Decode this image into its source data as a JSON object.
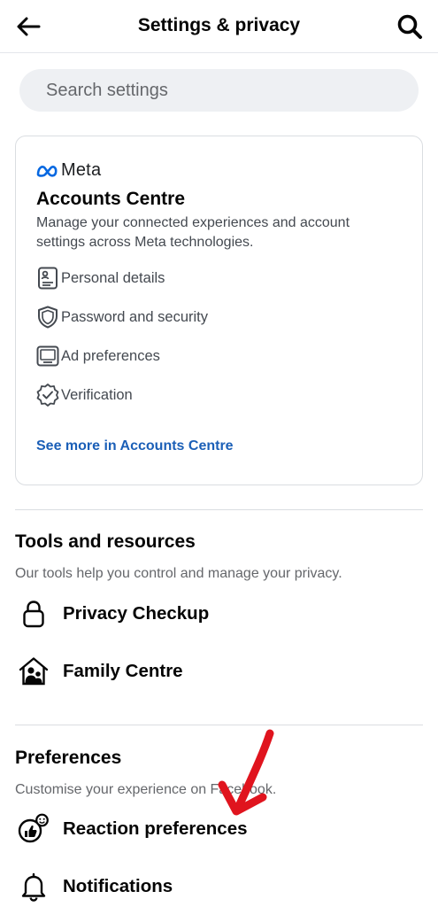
{
  "header": {
    "title": "Settings & privacy",
    "back_icon": "back-arrow-icon",
    "search_icon": "search-icon"
  },
  "search": {
    "placeholder": "Search settings"
  },
  "accounts_centre": {
    "brand": "Meta",
    "title": "Accounts Centre",
    "description": "Manage your connected experiences and account settings across Meta technologies.",
    "items": [
      {
        "label": "Personal details",
        "icon": "id-card-icon"
      },
      {
        "label": "Password and security",
        "icon": "shield-icon"
      },
      {
        "label": "Ad preferences",
        "icon": "monitor-icon"
      },
      {
        "label": "Verification",
        "icon": "verified-badge-icon"
      }
    ],
    "see_more": "See more in Accounts Centre"
  },
  "tools": {
    "title": "Tools and resources",
    "description": "Our tools help you control and manage your privacy.",
    "items": [
      {
        "label": "Privacy Checkup",
        "icon": "lock-icon"
      },
      {
        "label": "Family Centre",
        "icon": "family-house-icon"
      }
    ]
  },
  "preferences": {
    "title": "Preferences",
    "description": "Customise your experience on Facebook.",
    "items": [
      {
        "label": "Reaction preferences",
        "icon": "reaction-icon"
      },
      {
        "label": "Notifications",
        "icon": "bell-icon"
      }
    ]
  },
  "colors": {
    "link": "#1b5fb7",
    "meta_blue": "#0668e1",
    "annotation_arrow": "#e0141e"
  }
}
